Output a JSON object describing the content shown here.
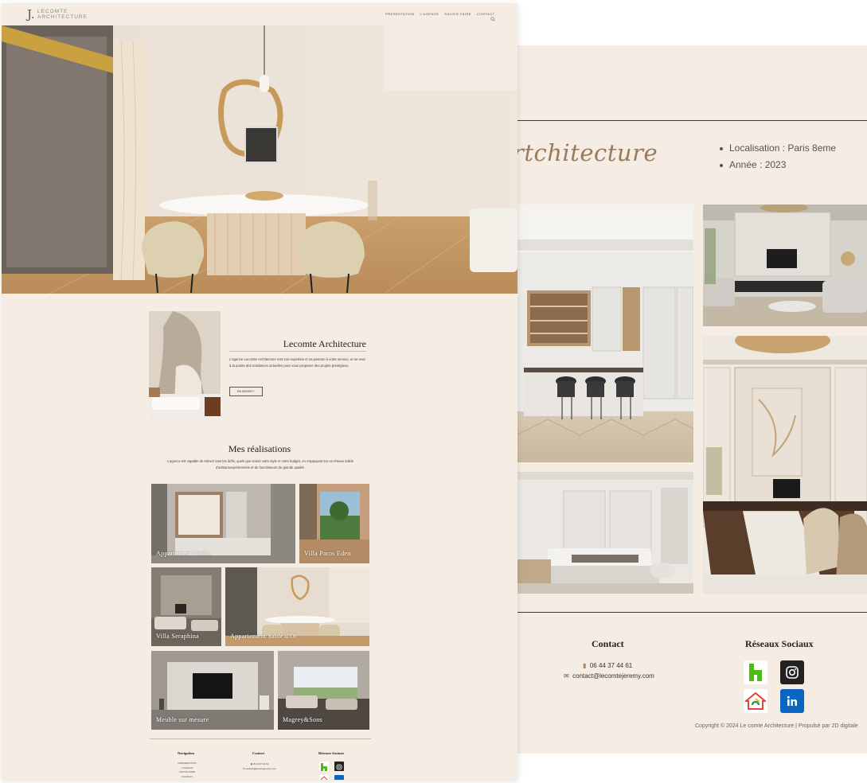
{
  "right_page": {
    "project_title": "rtchitecture",
    "info": [
      "Localisation : Paris 8eme",
      "Année : 2023"
    ],
    "contact": {
      "heading": "Contact",
      "phone": "06 44 37 44 61",
      "email": "contact@lecomtejeremy.com"
    },
    "social": {
      "heading": "Réseaux Sociaux",
      "icons": [
        "houzz-icon",
        "instagram-icon",
        "maison-icon",
        "linkedin-icon"
      ]
    },
    "copyright": "Copyright © 2024 Le comte Architecture | Propulsé par 2D digitale"
  },
  "left_page": {
    "logo": {
      "line1": "LECOMTE",
      "line2": "ARCHITECTURE"
    },
    "nav": [
      "PRESENTATION",
      "L'AGENCE",
      "SAVOIR FAIRE",
      "CONTACT"
    ],
    "about": {
      "title": "Lecomte Architecture",
      "text": "L'agence Lecomte Architecture met son expertise et sa passion à votre service, et se veut à la pointe des tendances actuelles pour vous proposer des projets prestigieux.",
      "button": "EN SAVOIR +"
    },
    "realisations": {
      "title": "Mes réalisations",
      "text": "L'agence est capable de relever tous les défis, quels que soient votre style et votre budget, en s'appuyant sur un réseau solide d'artisansexpérimentés et de fournisseurs de grande qualité.",
      "projects": [
        "Appartement Roche",
        "Villa Paros Eden",
        "Villa Seraphina",
        "Appartement Sable d'Or",
        "Meuble sur mesure",
        "Magrey&Sons"
      ]
    },
    "footer": {
      "navigation_heading": "Navigation",
      "navigation_items": [
        "PRESENTATION",
        "L'AGENCE",
        "SAVOIR FAIRE",
        "CONTACT"
      ],
      "contact_heading": "Contact",
      "phone": "06 44 37 44 61",
      "email": "contact@lecomtejeremy.com",
      "social_heading": "Réseaux Sociaux"
    }
  },
  "colors": {
    "background": "#f5ece3",
    "accent": "#9a7a5a",
    "linkedin": "#0a66c2",
    "instagram_bg": "#222222"
  }
}
